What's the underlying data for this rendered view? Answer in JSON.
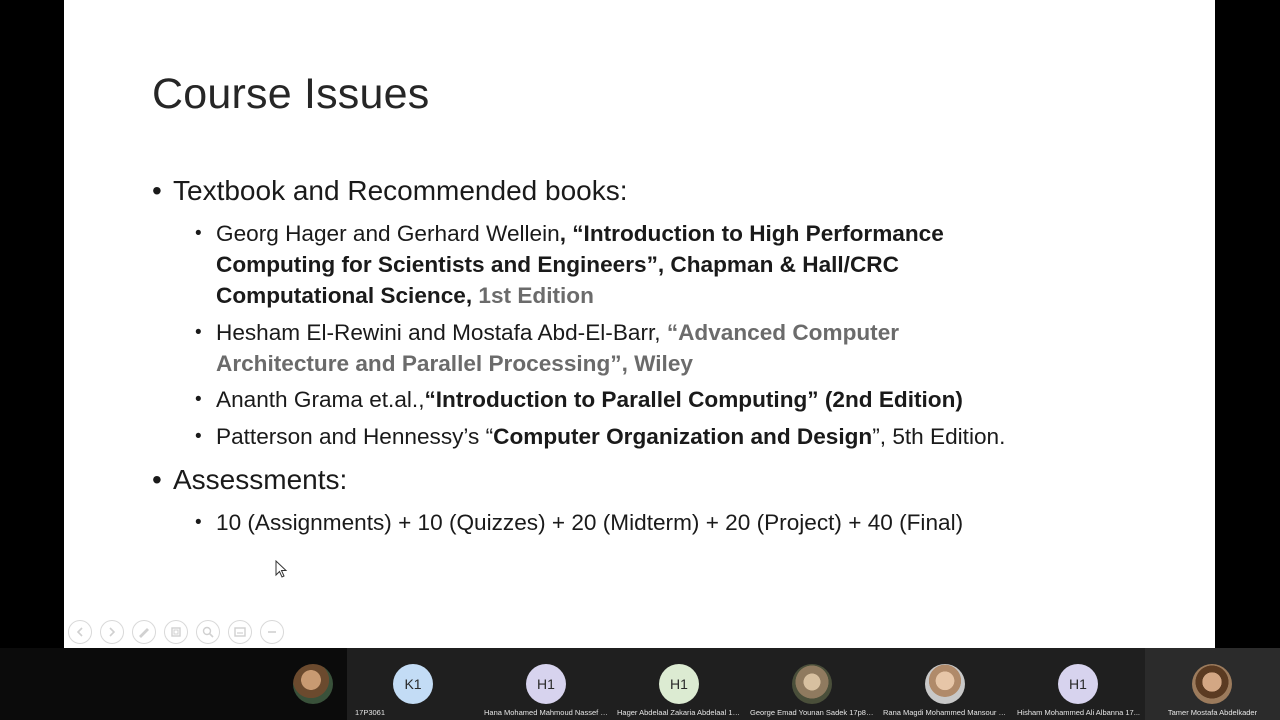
{
  "slide": {
    "title": "Course Issues",
    "sections": [
      {
        "heading": "Textbook and Recommended books:",
        "items": [
          {
            "lines": [
              [
                {
                  "t": "Georg Hager and Gerhard Wellein",
                  "s": "normal"
                },
                {
                  "t": ", “Introduction to High Performance",
                  "s": "bold"
                }
              ],
              [
                {
                  "t": "Computing for Scientists and Engineers”, Chapman & Hall/CRC",
                  "s": "bold"
                }
              ],
              [
                {
                  "t": "Computational Science, ",
                  "s": "bold"
                },
                {
                  "t": "1st Edition",
                  "s": "boldgray"
                }
              ]
            ]
          },
          {
            "lines": [
              [
                {
                  "t": "Hesham El-Rewini and Mostafa Abd-El-Barr, ",
                  "s": "normal"
                },
                {
                  "t": "“Advanced Computer",
                  "s": "boldgray"
                }
              ],
              [
                {
                  "t": "Architecture and Parallel Processing”, Wiley",
                  "s": "boldgray"
                }
              ]
            ]
          },
          {
            "lines": [
              [
                {
                  "t": "Ananth Grama et.al.,",
                  "s": "normal"
                },
                {
                  "t": "“Introduction to Parallel Computing” (2nd Edition)",
                  "s": "bold"
                }
              ]
            ]
          },
          {
            "lines": [
              [
                {
                  "t": "Patterson and Hennessy’s “",
                  "s": "normal"
                },
                {
                  "t": "Computer Organization and Design",
                  "s": "bold"
                },
                {
                  "t": "”, 5th Edition.",
                  "s": "normal"
                }
              ]
            ]
          }
        ]
      },
      {
        "heading": "Assessments:",
        "items": [
          {
            "lines": [
              [
                {
                  "t": "10 (Assignments) + 10 (Quizzes) + 20 (Midterm) + 20 (Project) + 40 (Final)",
                  "s": "normal"
                }
              ]
            ]
          }
        ]
      }
    ]
  },
  "slide_toolbar": {
    "icons": [
      "previous-slide-icon",
      "next-slide-icon",
      "pen-icon",
      "see-all-slides-icon",
      "zoom-icon",
      "subtitles-icon",
      "more-options-icon"
    ]
  },
  "participants": [
    {
      "initials": "",
      "name": "",
      "avatar": "photo"
    },
    {
      "initials": "K1",
      "name": "17P3061",
      "avatar": "k1"
    },
    {
      "initials": "H1",
      "name": "Hana Mohamed Mahmoud Nassef 1...",
      "avatar": "h1"
    },
    {
      "initials": "H1",
      "name": "Hager Abdelaal Zakaria Abdelaal 17...",
      "avatar": "h1g"
    },
    {
      "initials": "",
      "name": "George Emad Younan Sadek 17p8182",
      "avatar": "photo2"
    },
    {
      "initials": "",
      "name": "Rana Magdi Mohammed Mansour 1...",
      "avatar": "photo3"
    },
    {
      "initials": "H1",
      "name": "Hisham Mohammed Ali Albanna 17...",
      "avatar": "h1"
    },
    {
      "initials": "",
      "name": "Tamer Mostafa Abdelkader",
      "avatar": "photo4"
    }
  ]
}
